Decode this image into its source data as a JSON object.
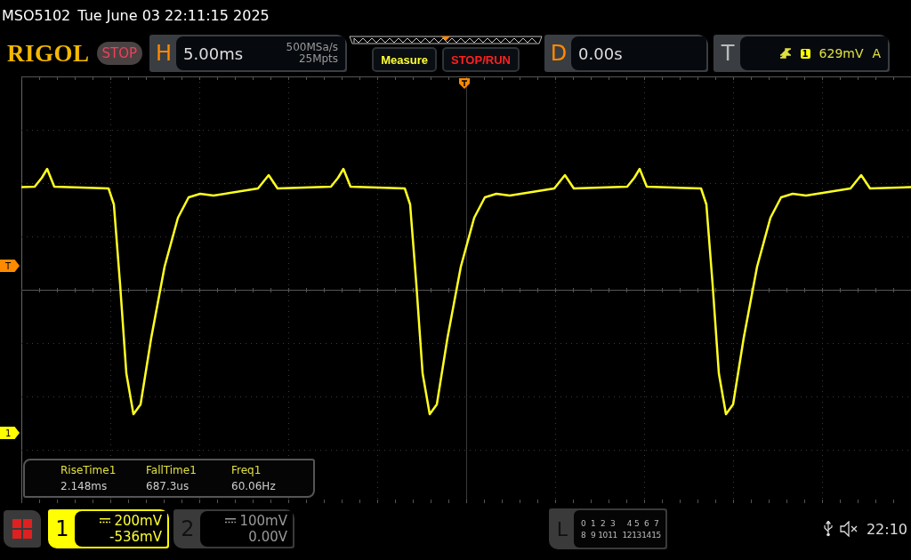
{
  "header": {
    "model": "MSO5102",
    "datetime": "Tue June 03 22:11:15 2025"
  },
  "toolbar": {
    "logo": "RIGOL",
    "run_state": "STOP",
    "horizontal": {
      "label": "H",
      "timebase": "5.00ms",
      "sample_rate": "500MSa/s",
      "memory_depth": "25Mpts"
    },
    "buttons": [
      {
        "label": "Measure",
        "kind": "measure"
      },
      {
        "label": "STOP/RUN",
        "kind": "stoprun"
      }
    ],
    "delay": {
      "label": "D",
      "value": "0.00s"
    },
    "trigger": {
      "label": "T",
      "source": "1",
      "level": "629mV",
      "mode": "A"
    }
  },
  "screen": {
    "markers": [
      {
        "label": "T",
        "kind": "trigger"
      },
      {
        "label": "1",
        "kind": "channel"
      }
    ],
    "measurements": [
      {
        "name": "RiseTime1",
        "value": "2.148ms"
      },
      {
        "name": "FallTime1",
        "value": "687.3us"
      },
      {
        "name": "Freq1",
        "value": "60.06Hz"
      }
    ]
  },
  "channels": [
    {
      "number": "1",
      "scale": "200mV",
      "offset": "-536mV",
      "selected": true
    },
    {
      "number": "2",
      "scale": "100mV",
      "offset": "0.00V",
      "selected": false
    }
  ],
  "logic": {
    "label": "L",
    "rows": [
      [
        "0",
        "1",
        "2",
        "3",
        "4",
        "5",
        "6",
        "7"
      ],
      [
        "8",
        "9",
        "10",
        "11",
        "12",
        "13",
        "14",
        "15"
      ]
    ]
  },
  "status": {
    "time": "22:10"
  }
}
